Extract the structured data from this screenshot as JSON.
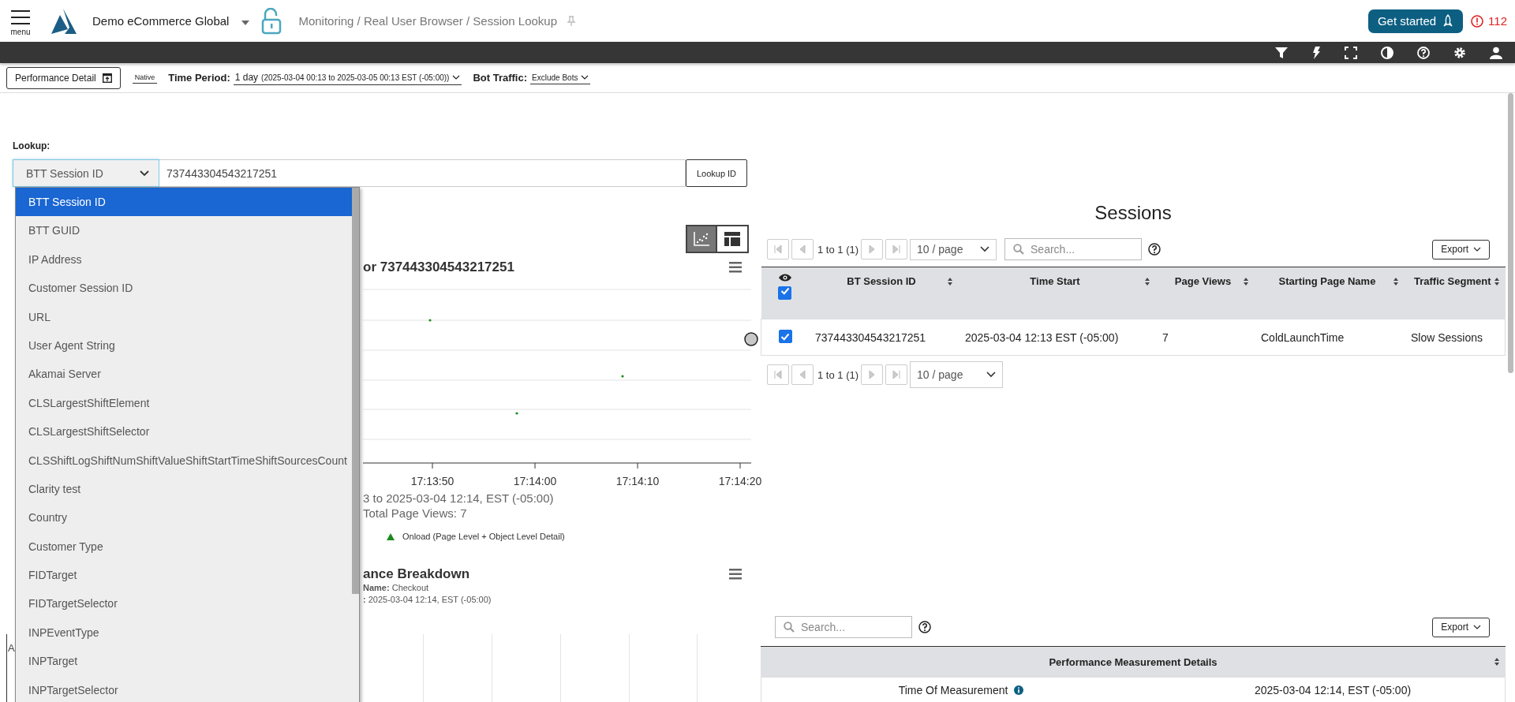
{
  "header": {
    "menu_label": "menu",
    "org": "Demo eCommerce Global",
    "breadcrumb": "Monitoring / Real User Browser / Session Lookup",
    "get_started": "Get started",
    "alert_count": "112"
  },
  "filters": {
    "perf_button": "Performance Detail",
    "native": "Native",
    "time_label": "Time Period:",
    "time_value": "1 day",
    "time_range": "(2025-03-04 00:13 to 2025-03-05 00:13 EST (-05:00))",
    "bot_label": "Bot Traffic:",
    "bot_value": "Exclude Bots"
  },
  "lookup": {
    "label": "Lookup:",
    "type": "BTT Session ID",
    "value": "737443304543217251",
    "button": "Lookup ID",
    "expanded": true,
    "options": [
      {
        "label": "BTT Session ID",
        "selected": true
      },
      {
        "label": "BTT GUID",
        "selected": false
      },
      {
        "label": "IP Address",
        "selected": false
      },
      {
        "label": "Customer Session ID",
        "selected": false
      },
      {
        "label": "URL",
        "selected": false
      },
      {
        "label": "User Agent String",
        "selected": false
      },
      {
        "label": "Akamai Server",
        "selected": false
      },
      {
        "label": "CLSLargestShiftElement",
        "selected": false
      },
      {
        "label": "CLSLargestShiftSelector",
        "selected": false
      },
      {
        "label": "CLSShiftLogShiftNumShiftValueShiftStartTimeShiftSourcesCount",
        "selected": false
      },
      {
        "label": "Clarity test",
        "selected": false
      },
      {
        "label": "Country",
        "selected": false
      },
      {
        "label": "Customer Type",
        "selected": false
      },
      {
        "label": "FIDTarget",
        "selected": false
      },
      {
        "label": "FIDTargetSelector",
        "selected": false
      },
      {
        "label": "INPEventType",
        "selected": false
      },
      {
        "label": "INPTarget",
        "selected": false
      },
      {
        "label": "INPTargetSelector",
        "selected": false
      }
    ]
  },
  "view_toggle": [
    {
      "kind": "chart",
      "selected": true
    },
    {
      "kind": "table",
      "selected": false
    }
  ],
  "session_chart": {
    "title": "or 737443304543217251",
    "xticks": [
      "17:13:50",
      "17:14:00",
      "17:14:10",
      "17:14:20"
    ],
    "range_text": "3 to 2025-03-04 12:14, EST (-05:00)",
    "total_text": "Total Page Views: 7",
    "legend": "Onload (Page Level + Object Level Detail)"
  },
  "breakdown": {
    "title": "ance Breakdown",
    "lines": [
      "**Name:** Checkout",
      "**:** 2025-03-04 12:14, EST (-05:00)"
    ],
    "fragment": "A"
  },
  "sessions": {
    "title": "Sessions",
    "pager": "1 to 1 (1)",
    "page_size": "10 / page",
    "search_placeholder": "Search...",
    "export": "Export",
    "header_checked": true,
    "columns": [
      "BT Session ID",
      "Time Start",
      "Page Views",
      "Starting Page Name",
      "Traffic Segment"
    ],
    "rows": [
      {
        "checked": true,
        "cells": [
          "737443304543217251",
          "2025-03-04 12:13 EST (-05:00)",
          "7",
          "ColdLaunchTime",
          "Slow Sessions"
        ]
      }
    ],
    "bottom_pager": "1 to 1 (1)",
    "bottom_page_size": "10 / page"
  },
  "details": {
    "search_placeholder": "Search...",
    "export": "Export",
    "title": "Performance Measurement Details",
    "rows": [
      {
        "label": "Time Of Measurement",
        "value": "2025-03-04 12:14, EST (-05:00)"
      }
    ]
  }
}
